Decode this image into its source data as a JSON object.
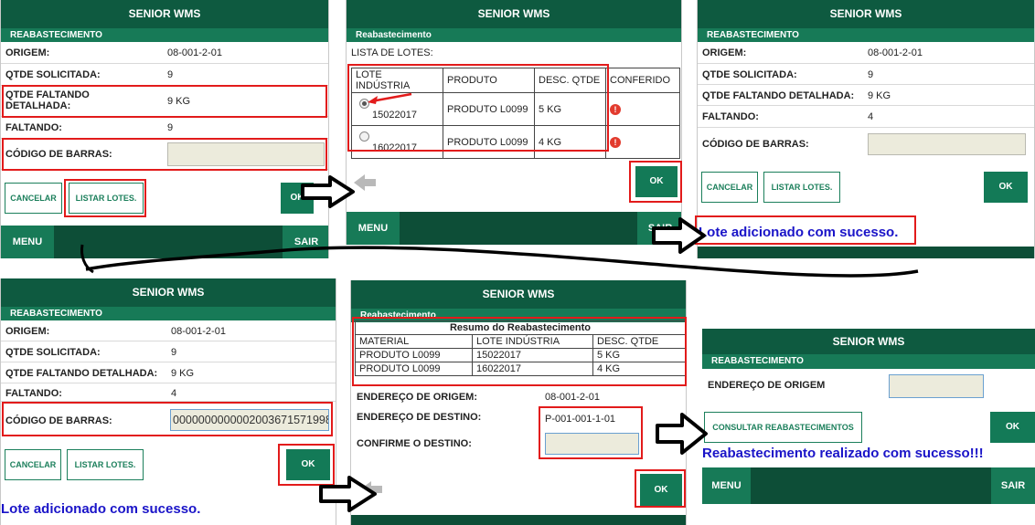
{
  "app": {
    "title": "SENIOR WMS",
    "section": "REABASTECIMENTO",
    "section_alt": "Reabastecimento"
  },
  "colors": {
    "header": "#0e5a40",
    "accent": "#177a57",
    "highlight": "#e21b1b",
    "message": "#1a14c8"
  },
  "labels": {
    "origem": "ORIGEM:",
    "qtde_solicitada": "QTDE SOLICITADA:",
    "qtde_faltando_detalhada": "QTDE FALTANDO DETALHADA:",
    "faltando": "FALTANDO:",
    "codigo_barras": "CÓDIGO DE BARRAS:",
    "lista_lotes": "LISTA DE LOTES:",
    "endereco_origem": "ENDEREÇO DE ORIGEM:",
    "endereco_destino": "ENDEREÇO DE DESTINO:",
    "confirme_destino": "CONFIRME O DESTINO:",
    "endereco_de_origem": "ENDEREÇO DE ORIGEM"
  },
  "buttons": {
    "cancelar": "CANCELAR",
    "listar_lotes": "LISTAR LOTES.",
    "ok": "OK",
    "menu": "MENU",
    "sair": "SAIR",
    "consultar": "CONSULTAR REABASTECIMENTOS"
  },
  "values": {
    "origem": "08-001-2-01",
    "qtde_solicitada": "9",
    "qtde_faltando_1": "9 KG",
    "faltando_1": "9",
    "qtde_faltando_2": "9 KG",
    "faltando_2": "4",
    "barcode": "0000000000002003671571998",
    "destino": "P-001-001-1-01"
  },
  "lotes_table": {
    "headers": [
      "LOTE INDÚSTRIA",
      "PRODUTO",
      "DESC. QTDE",
      "CONFERIDO"
    ],
    "rows": [
      {
        "lote": "15022017",
        "produto": "PRODUTO L0099",
        "qtde": "5 KG",
        "selected": true
      },
      {
        "lote": "16022017",
        "produto": "PRODUTO L0099",
        "qtde": "4 KG",
        "selected": false
      }
    ]
  },
  "resumo": {
    "title": "Resumo do Reabastecimento",
    "headers": [
      "MATERIAL",
      "LOTE INDÚSTRIA",
      "DESC. QTDE"
    ],
    "rows": [
      {
        "material": "PRODUTO L0099",
        "lote": "15022017",
        "qtde": "5 KG"
      },
      {
        "material": "PRODUTO L0099",
        "lote": "16022017",
        "qtde": "4 KG"
      }
    ]
  },
  "messages": {
    "lote_adicionado": "Lote adicionado com sucesso.",
    "reabastecimento_ok": "Reabastecimento realizado com sucesso!!!"
  }
}
